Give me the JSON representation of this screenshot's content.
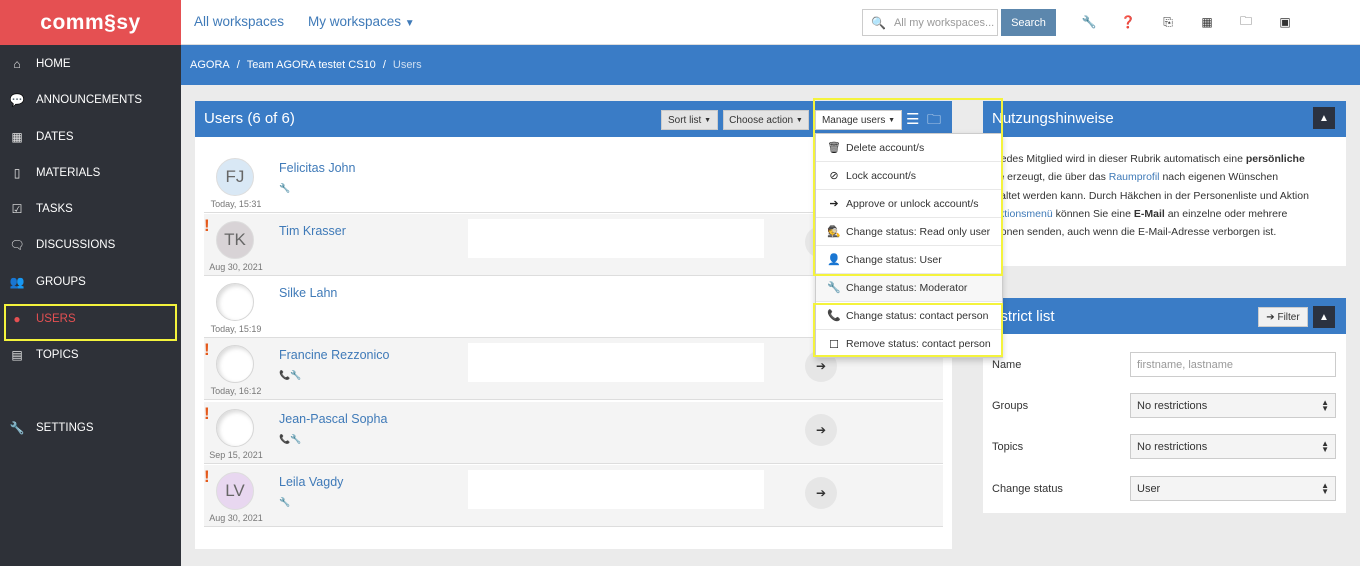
{
  "app": {
    "logo": "comm§sy"
  },
  "sidebar": {
    "items": [
      {
        "label": "HOME",
        "icon": "home-icon"
      },
      {
        "label": "ANNOUNCEMENTS",
        "icon": "speech-bubble-icon"
      },
      {
        "label": "DATES",
        "icon": "calendar-icon"
      },
      {
        "label": "MATERIALS",
        "icon": "document-icon"
      },
      {
        "label": "TASKS",
        "icon": "checkbox-icon"
      },
      {
        "label": "DISCUSSIONS",
        "icon": "chat-icon"
      },
      {
        "label": "GROUPS",
        "icon": "group-icon"
      },
      {
        "label": "USERS",
        "icon": "user-icon",
        "active": true
      },
      {
        "label": "TOPICS",
        "icon": "book-icon"
      },
      {
        "label": "SETTINGS",
        "icon": "wrench-icon"
      }
    ]
  },
  "topbar": {
    "all_workspaces": "All workspaces",
    "my_workspaces": "My workspaces",
    "search_placeholder": "All my workspaces...",
    "search_button": "Search",
    "icons": [
      "wrench-icon",
      "help-icon",
      "clipboard-icon",
      "table-icon",
      "folder-icon",
      "qr-icon"
    ]
  },
  "breadcrumb": {
    "items": [
      "AGORA",
      "Team AGORA testet CS10",
      "Users"
    ]
  },
  "users_panel": {
    "title": "Users (6 of 6)",
    "sort_list": "Sort list",
    "choose_action": "Choose action",
    "manage_users": "Manage users",
    "manage_menu": [
      {
        "label": "Delete account/s",
        "icon": "trash-icon"
      },
      {
        "label": "Lock account/s",
        "icon": "ban-icon"
      },
      {
        "label": "Approve or unlock account/s",
        "icon": "sign-in-icon"
      },
      {
        "label": "Change status: Read only user",
        "icon": "user-secret-icon"
      },
      {
        "label": "Change status: User",
        "icon": "user-icon"
      },
      {
        "label": "Change status: Moderator",
        "icon": "wrench-icon"
      },
      {
        "label": "Change status: contact person",
        "icon": "phone-icon"
      },
      {
        "label": "Remove status: contact person",
        "icon": "checkbox-empty-icon"
      }
    ],
    "users": [
      {
        "initials": "FJ",
        "name": "Felicitas John",
        "date": "Today, 15:31",
        "flag": false,
        "icons": "🔧",
        "avatar_color": "#d9e8f5"
      },
      {
        "initials": "TK",
        "name": "Tim Krasser",
        "date": "Aug 30, 2021",
        "flag": true,
        "icons": "",
        "avatar_color": "#d8d3d6"
      },
      {
        "initials": "",
        "name": "Silke Lahn",
        "date": "Today, 15:19",
        "flag": false,
        "icons": "",
        "avatar_color": "#ffffff"
      },
      {
        "initials": "",
        "name": "Francine Rezzonico",
        "date": "Today, 16:12",
        "flag": true,
        "icons": "📞🔧",
        "avatar_color": "#ffffff"
      },
      {
        "initials": "",
        "name": "Jean-Pascal Sopha",
        "date": "Sep 15, 2021",
        "flag": true,
        "icons": "📞🔧",
        "avatar_color": "#ffffff"
      },
      {
        "initials": "LV",
        "name": "Leila Vagdy",
        "date": "Aug 30, 2021",
        "flag": true,
        "icons": "🔧",
        "avatar_color": "#e8d7f0"
      }
    ]
  },
  "nutzung": {
    "title": "Nutzungshinweise",
    "l1a": "r jedes Mitglied wird in dieser Rubrik automatisch eine ",
    "l1b": "persönliche",
    "l2a": "ite",
    "l2b": " erzeugt, die über das ",
    "l2c": "Raumprofil",
    "l2d": " nach eigenen Wünschen",
    "l3": "staltet werden kann. Durch Häkchen in der Personenliste und Aktion",
    "l4a": "Aktionsmenü",
    "l4b": " können Sie eine ",
    "l4c": "E-Mail",
    "l4d": " an einzelne oder mehrere",
    "l5": "rsonen senden, auch wenn die E-Mail-Adresse verborgen ist."
  },
  "restrict": {
    "title": "estrict list",
    "filter_button": "Filter",
    "name_label": "Name",
    "name_placeholder": "firstname, lastname",
    "groups_label": "Groups",
    "groups_value": "No restrictions",
    "topics_label": "Topics",
    "topics_value": "No restrictions",
    "status_label": "Change status",
    "status_value": "User"
  },
  "colors": {
    "brand": "#e55052",
    "primary": "#3a7cc6",
    "sidebar": "#2e3138",
    "highlight": "#f4f33c"
  }
}
